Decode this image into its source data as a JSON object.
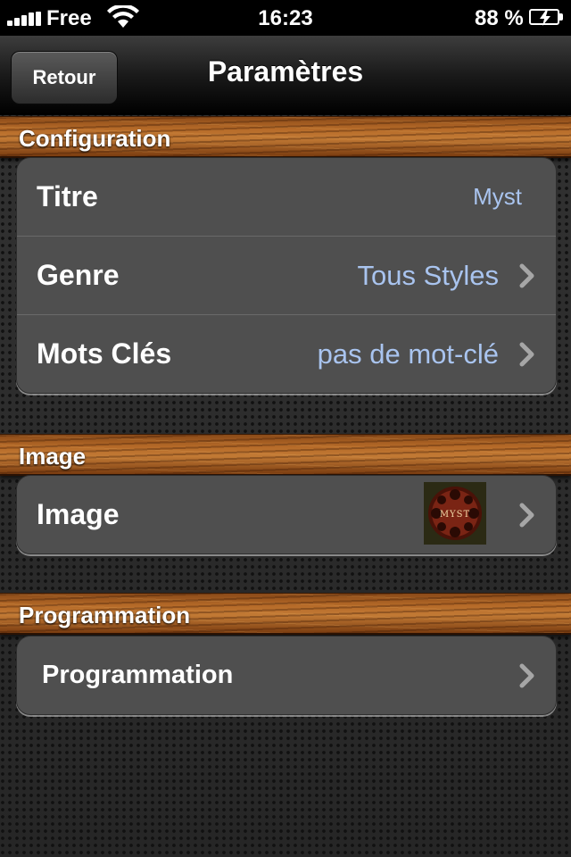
{
  "status_bar": {
    "carrier": "Free",
    "time": "16:23",
    "battery_percent": "88 %"
  },
  "nav": {
    "back_label": "Retour",
    "title": "Paramètres"
  },
  "sections": {
    "configuration": {
      "header": "Configuration",
      "rows": [
        {
          "label": "Titre",
          "value": "Myst"
        },
        {
          "label": "Genre",
          "value": "Tous Styles"
        },
        {
          "label": "Mots Clés",
          "value": "pas de mot-clé"
        }
      ]
    },
    "image": {
      "header": "Image",
      "rows": [
        {
          "label": "Image",
          "thumbnail_text": "MYST"
        }
      ]
    },
    "programmation": {
      "header": "Programmation",
      "rows": [
        {
          "label": "Programmation"
        }
      ]
    }
  },
  "colors": {
    "value_text": "#a9c4ef",
    "cell_background": "#4f4f4f",
    "wood": "#b56a28"
  }
}
